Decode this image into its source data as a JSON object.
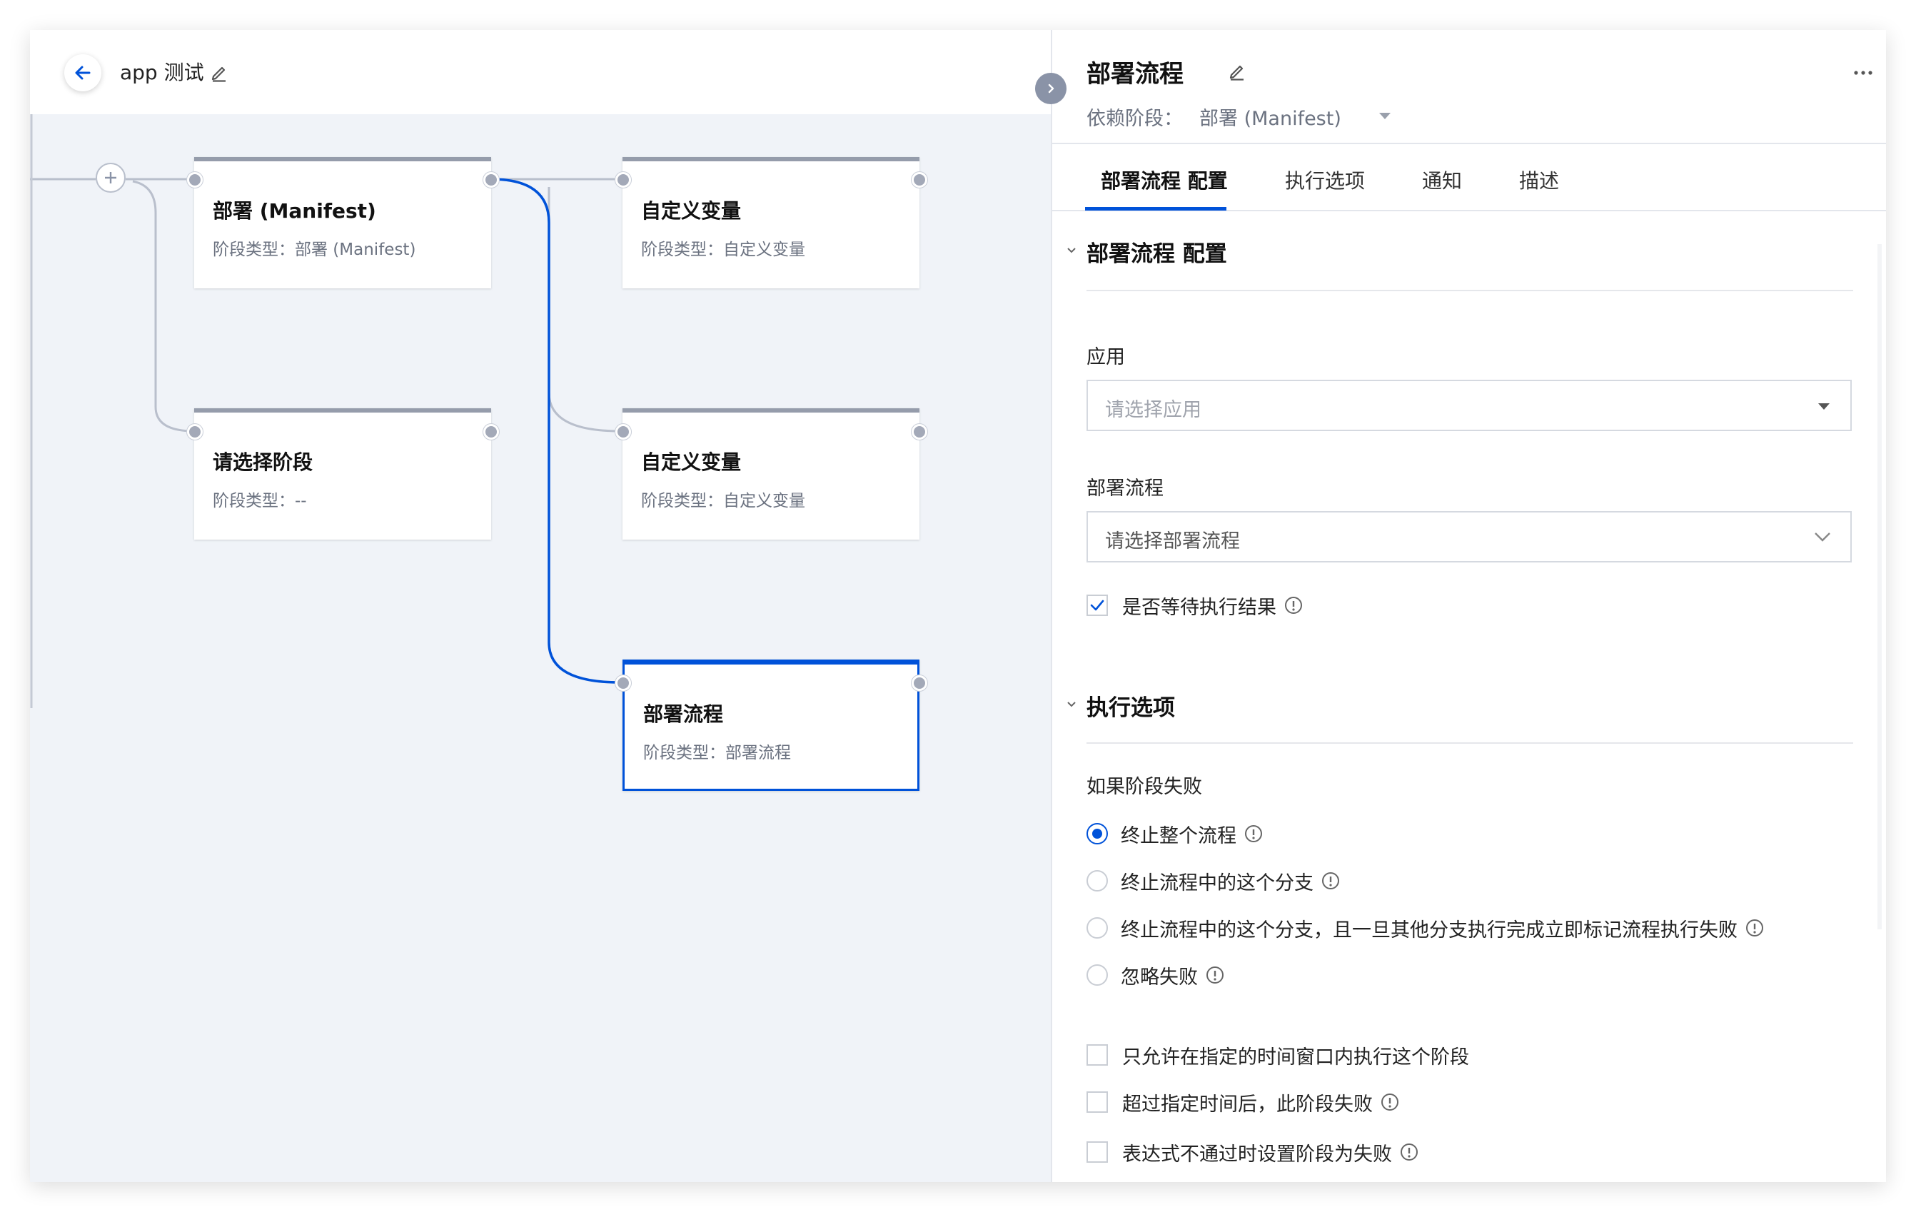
{
  "header": {
    "title": "app 测试"
  },
  "stages": [
    {
      "title": "部署 (Manifest)",
      "type_label": "阶段类型：",
      "type_value": "部署 (Manifest)"
    },
    {
      "title": "自定义变量",
      "type_label": "阶段类型：",
      "type_value": "自定义变量"
    },
    {
      "title": "请选择阶段",
      "type_label": "阶段类型：",
      "type_value": "--"
    },
    {
      "title": "自定义变量",
      "type_label": "阶段类型：",
      "type_value": "自定义变量"
    },
    {
      "title": "部署流程",
      "type_label": "阶段类型：",
      "type_value": "部署流程"
    }
  ],
  "panel": {
    "title": "部署流程",
    "dependency_label": "依赖阶段：",
    "dependency_value": "部署 (Manifest)",
    "tabs": [
      "部署流程 配置",
      "执行选项",
      "通知",
      "描述"
    ],
    "config_section": {
      "title": "部署流程 配置",
      "app_label": "应用",
      "app_placeholder": "请选择应用",
      "pipeline_label": "部署流程",
      "pipeline_placeholder": "请选择部署流程",
      "wait_result_label": "是否等待执行结果",
      "wait_result_checked": true
    },
    "exec_section": {
      "title": "执行选项",
      "fail_label": "如果阶段失败",
      "fail_options": [
        "终止整个流程",
        "终止流程中的这个分支",
        "终止流程中的这个分支，且一旦其他分支执行完成立即标记流程执行失败",
        "忽略失败"
      ],
      "fail_selected": 0,
      "checks": [
        {
          "label": "只允许在指定的时间窗口内执行这个阶段",
          "checked": false,
          "info": false
        },
        {
          "label": "超过指定时间后，此阶段失败",
          "checked": false,
          "info": true
        },
        {
          "label": "表达式不通过时设置阶段为失败",
          "checked": false,
          "info": true
        }
      ]
    }
  },
  "colors": {
    "accent": "#0052d9",
    "canvas_bg": "#f0f3f8",
    "connector": "#b9bfcc",
    "node_border": "#959cab",
    "muted_text": "#6b7280"
  },
  "icons": [
    "back-arrow-icon",
    "pencil-icon",
    "plus-icon",
    "chevron-right-icon",
    "more-icon",
    "caret-down-icon",
    "chevron-down-icon",
    "check-icon",
    "info-icon"
  ]
}
